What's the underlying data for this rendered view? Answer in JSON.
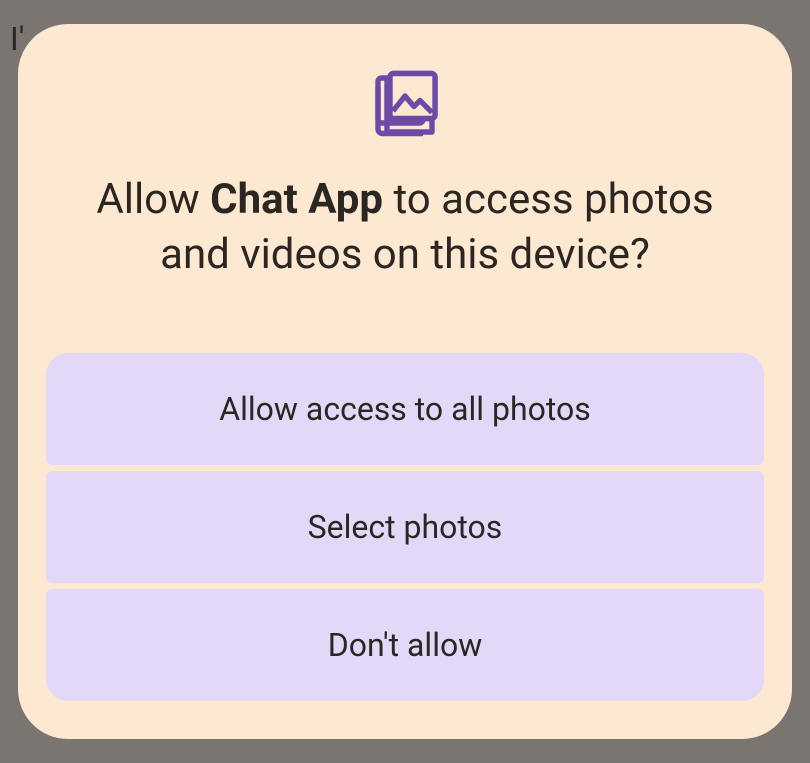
{
  "dialog": {
    "title_prefix": "Allow ",
    "app_name": "Chat App",
    "title_suffix": " to access photos and videos on this device?",
    "icon": "photo-gallery-icon",
    "colors": {
      "dialog_bg": "#fde9d1",
      "button_bg": "#e3d8f8",
      "icon_color": "#6d4aa8",
      "text_color": "#2b2622"
    },
    "buttons": [
      {
        "label": "Allow access to all photos"
      },
      {
        "label": "Select photos"
      },
      {
        "label": "Don't allow"
      }
    ]
  },
  "backdrop": {
    "partial_text": "I'"
  }
}
